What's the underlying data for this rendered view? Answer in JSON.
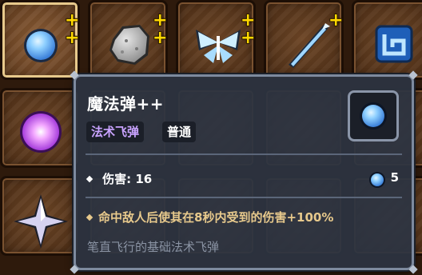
{
  "inventory": {
    "slots": [
      {
        "item": "blue-orb",
        "upgrades": 2,
        "selected": true
      },
      {
        "item": "stone",
        "upgrades": 2
      },
      {
        "item": "ice-butterfly",
        "upgrades": 2
      },
      {
        "item": "ice-lance",
        "upgrades": 1
      },
      {
        "item": "blue-rune",
        "upgrades": 0
      },
      {
        "item": "purple-sphere",
        "upgrades": 0
      },
      {
        "item": "silver-star",
        "upgrades": 0
      }
    ],
    "plus_glyph": "+"
  },
  "tooltip": {
    "title": "魔法弹++",
    "tags": {
      "type": "法术飞弹",
      "rarity": "普通"
    },
    "icon": "blue-orb-icon",
    "stats": {
      "damage_label": "伤害: 16",
      "mana_cost": "5",
      "mana_icon": "mana-orb-icon"
    },
    "effect": "命中敌人后使其在8秒内受到的伤害+100%",
    "description": "笔直飞行的基础法术飞弹"
  },
  "colors": {
    "tooltip_bg": "#2c3442",
    "tag_type": "#c9a3ff",
    "effect_text": "#e7c98c",
    "description_text": "#8a93a3",
    "plus": "#ffd800"
  }
}
